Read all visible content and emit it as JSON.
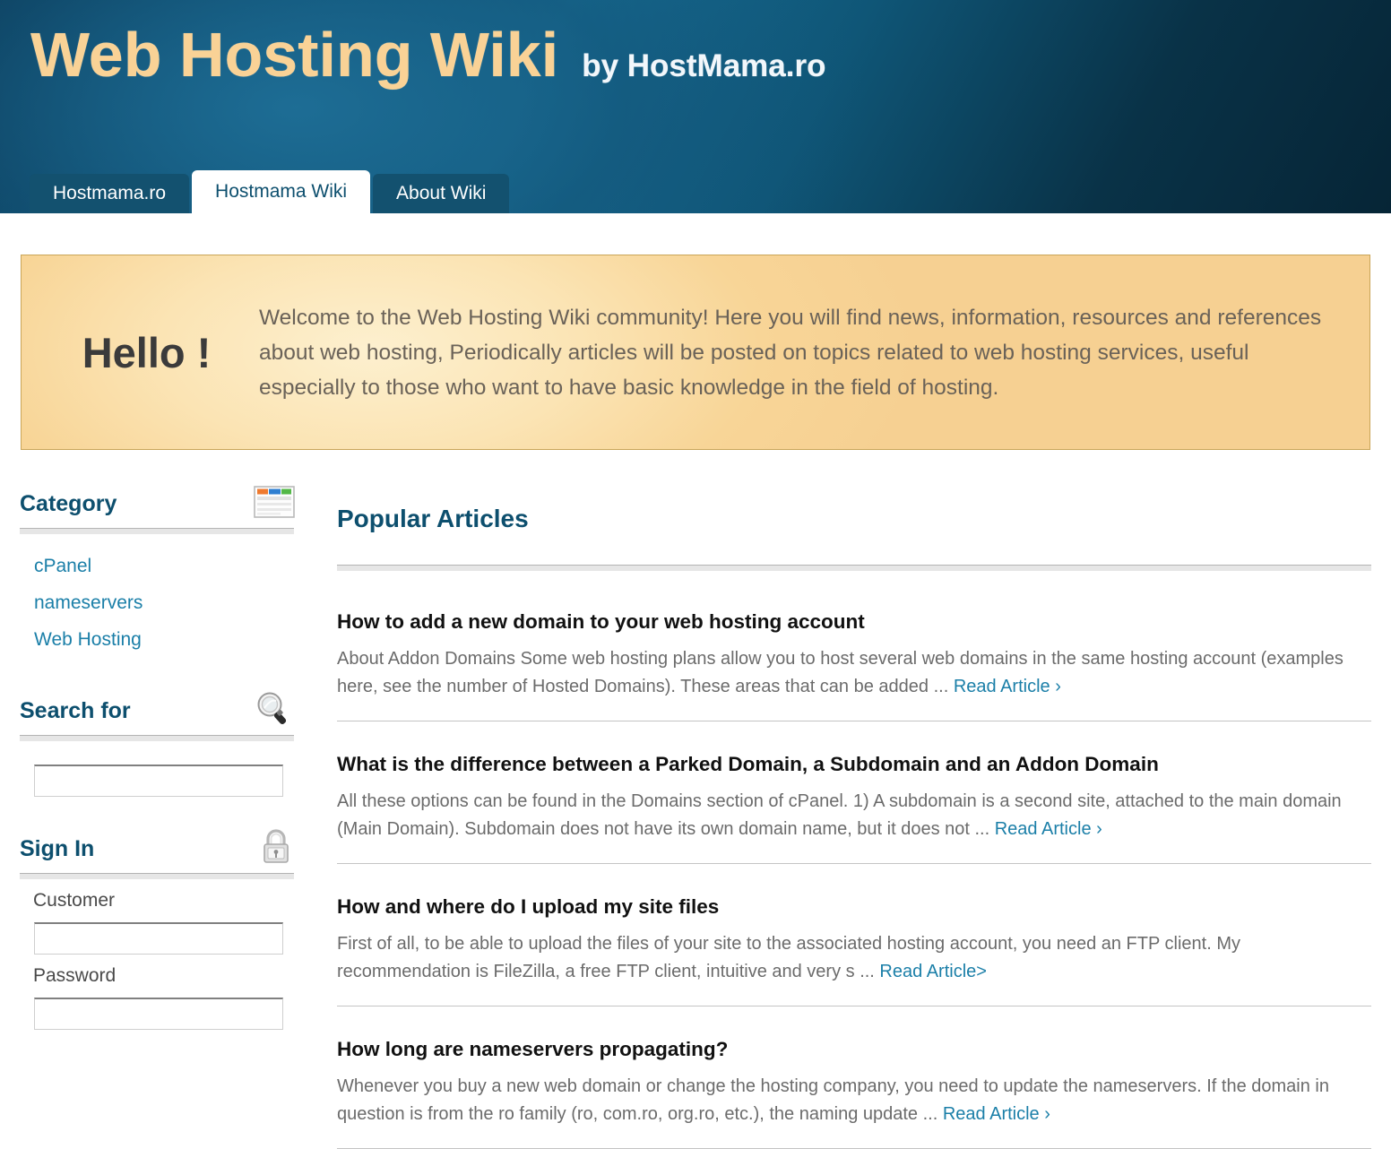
{
  "header": {
    "logo_main": "Web Hosting Wiki",
    "logo_by": "by HostMama.ro"
  },
  "tabs": [
    {
      "label": "Hostmama.ro",
      "active": false
    },
    {
      "label": "Hostmama Wiki",
      "active": true
    },
    {
      "label": "About Wiki",
      "active": false
    }
  ],
  "welcome": {
    "hello": "Hello !",
    "text": "Welcome to the Web Hosting Wiki community! Here you will find news, information, resources and references about web hosting, Periodically articles will be posted on topics related to web hosting services, useful especially to those who want to have basic knowledge in the field of hosting."
  },
  "sidebar": {
    "category": {
      "title": "Category",
      "icon": "news-document-icon",
      "items": [
        {
          "label": "cPanel"
        },
        {
          "label": "nameservers"
        },
        {
          "label": "Web Hosting"
        }
      ]
    },
    "search": {
      "title": "Search for",
      "icon": "magnifier-icon",
      "value": "",
      "placeholder": ""
    },
    "signin": {
      "title": "Sign In",
      "icon": "padlock-icon",
      "customer_label": "Customer",
      "customer_value": "",
      "password_label": "Password",
      "password_value": ""
    }
  },
  "main": {
    "heading": "Popular Articles",
    "articles": [
      {
        "title": "How to add a new domain to your web hosting account",
        "excerpt": "About Addon Domains Some web hosting plans allow you to host several web domains in the same hosting account (examples here, see the number of Hosted Domains). These areas that can be added ... ",
        "read_label": "Read Article ›"
      },
      {
        "title": "What is the difference between a Parked Domain, a Subdomain and an Addon Domain",
        "excerpt": "All these options can be found in the Domains section of cPanel. 1) A subdomain is a second site, attached to the main domain (Main Domain). Subdomain does not have its own domain name, but it does not ... ",
        "read_label": "Read Article ›"
      },
      {
        "title": "How and where do I upload my site files",
        "excerpt": "First of all, to be able to upload the files of your site to the associated hosting account, you need an FTP client. My recommendation is FileZilla, a free FTP client, intuitive and very s ... ",
        "read_label": "Read Article>"
      },
      {
        "title": "How long are nameservers propagating?",
        "excerpt": "Whenever you buy a new web domain or change the hosting company, you need to update the nameservers. If the domain in question is from the ro family (ro, com.ro, org.ro, etc.), the naming update ... ",
        "read_label": "Read Article ›"
      }
    ]
  },
  "colors": {
    "header_dark": "#093247",
    "header_teal": "#166b91",
    "logo_gold": "#f9d296",
    "banner_border": "#c9a558",
    "banner_bg": "#f8d597",
    "heading_blue": "#0d4f6e",
    "link_blue": "#1b7fa8",
    "body_text": "#6b6b6b"
  }
}
